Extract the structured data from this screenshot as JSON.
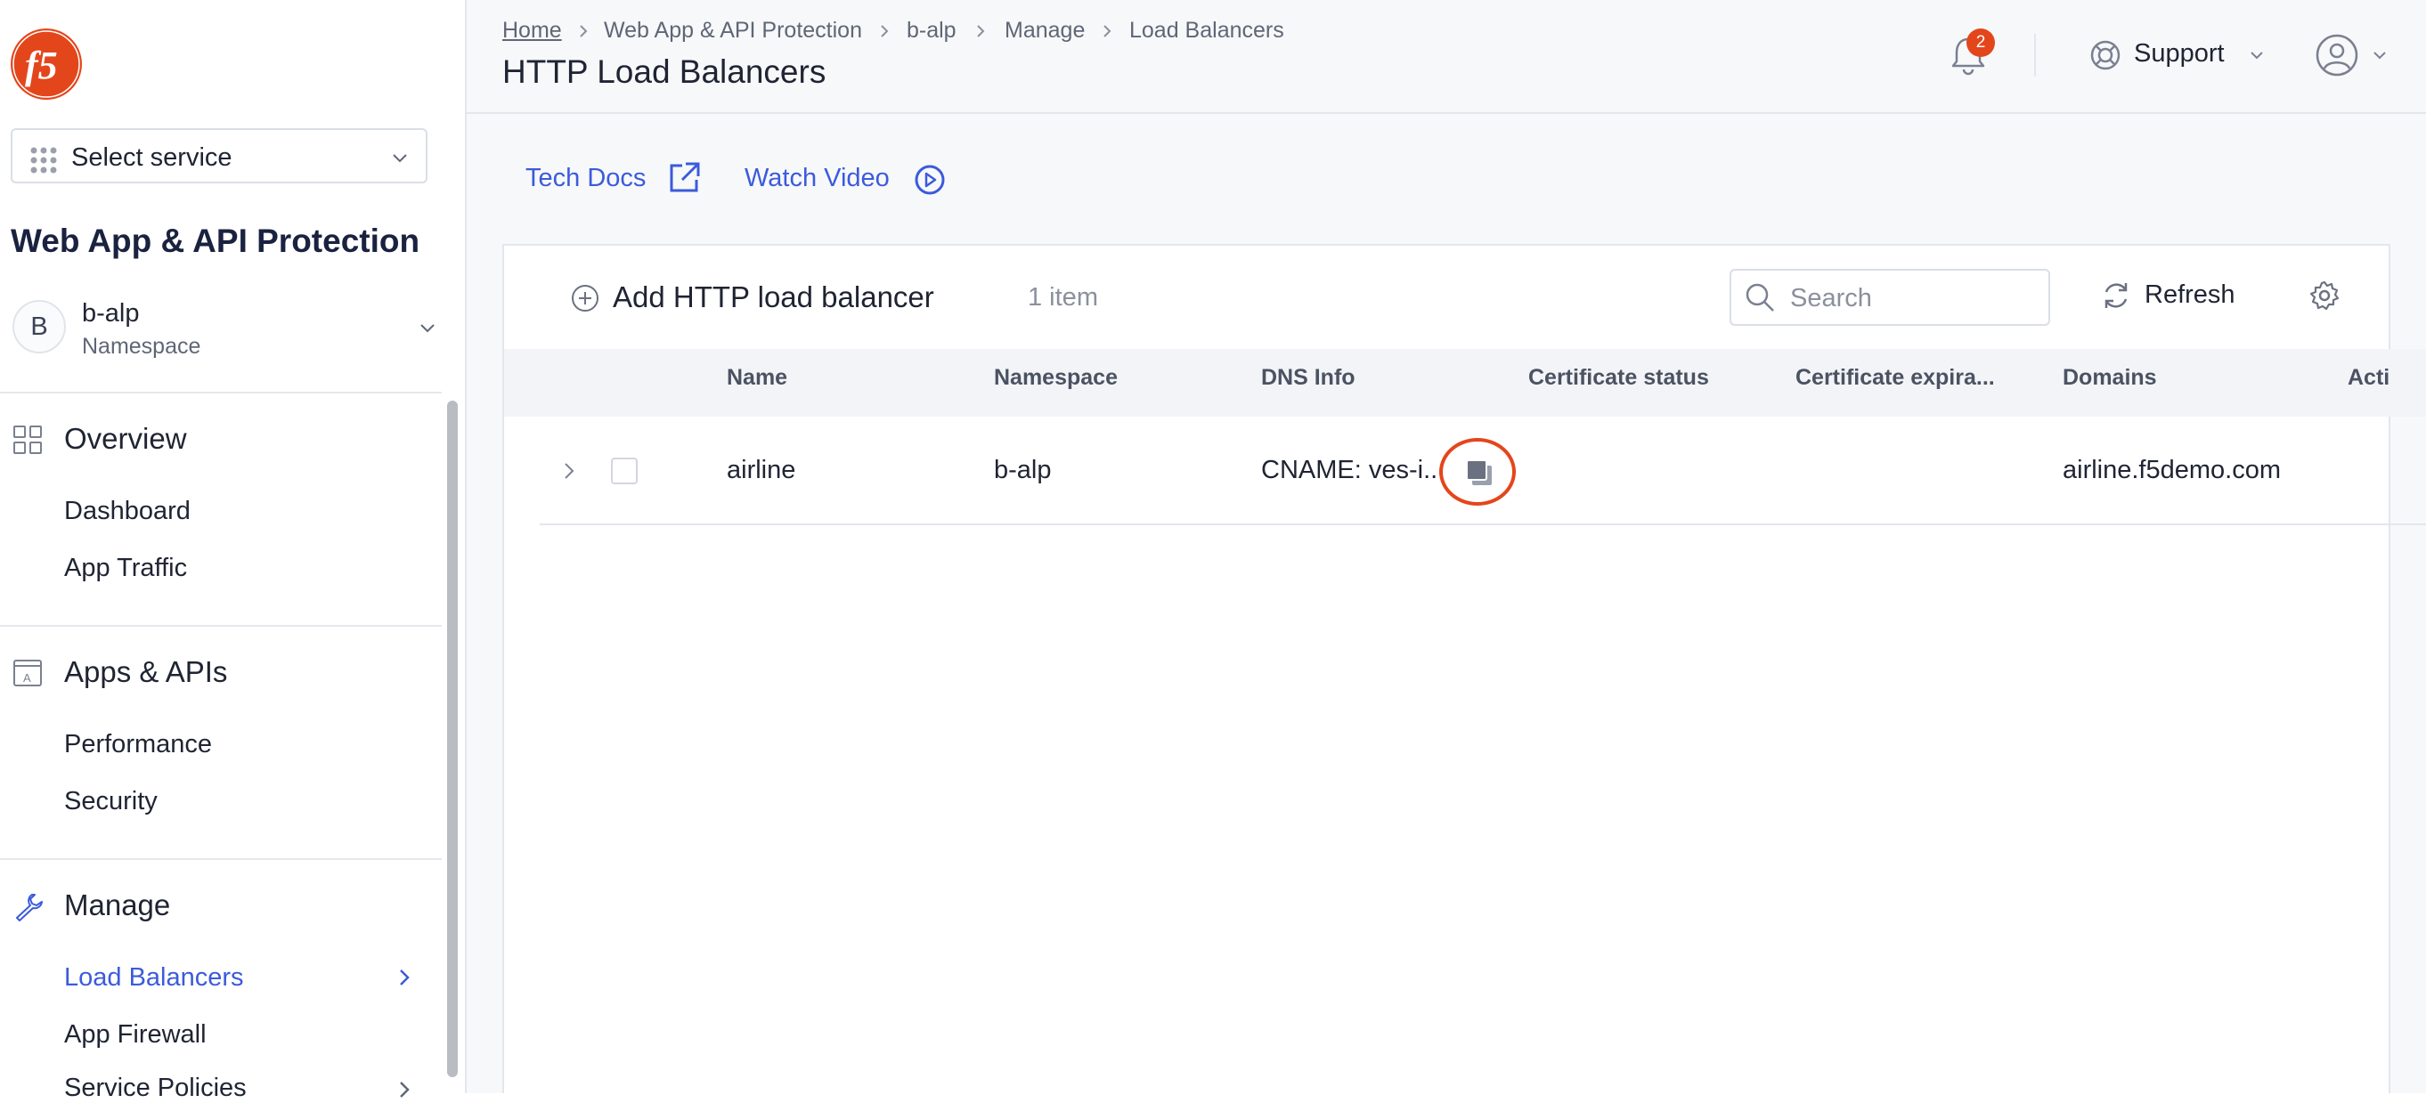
{
  "sidebar": {
    "service_select": {
      "label": "Select service"
    },
    "app_title": "Web App & API Protection",
    "namespace": {
      "initial": "B",
      "name": "b-alp",
      "label": "Namespace"
    },
    "sections": [
      {
        "title": "Overview",
        "icon": "grid-icon",
        "items": [
          "Dashboard",
          "App Traffic"
        ]
      },
      {
        "title": "Apps & APIs",
        "icon": "app-window-icon",
        "items": [
          "Performance",
          "Security"
        ]
      },
      {
        "title": "Manage",
        "icon": "wrench-icon",
        "items": [
          "Load Balancers",
          "App Firewall",
          "Service Policies"
        ]
      }
    ],
    "active_item": "Load Balancers"
  },
  "header": {
    "breadcrumb": [
      "Home",
      "Web App & API Protection",
      "b-alp",
      "Manage",
      "Load Balancers"
    ],
    "page_title": "HTTP Load Balancers",
    "notifications_count": "2",
    "support_label": "Support"
  },
  "links": {
    "tech_docs": "Tech Docs",
    "watch_video": "Watch Video"
  },
  "toolbar": {
    "add_label": "Add HTTP load balancer",
    "item_count": "1 item",
    "search_placeholder": "Search",
    "refresh_label": "Refresh"
  },
  "table": {
    "columns": [
      "Name",
      "Namespace",
      "DNS Info",
      "Certificate status",
      "Certificate expira...",
      "Domains",
      "Acti"
    ],
    "rows": [
      {
        "name": "airline",
        "namespace": "b-alp",
        "dns_info": "CNAME: ves-i..",
        "certificate_status": "",
        "certificate_expiration": "",
        "domains": "airline.f5demo.com"
      }
    ]
  },
  "colors": {
    "accent": "#3b5bdb",
    "brand_red": "#e4461b",
    "text": "#1f2433"
  }
}
